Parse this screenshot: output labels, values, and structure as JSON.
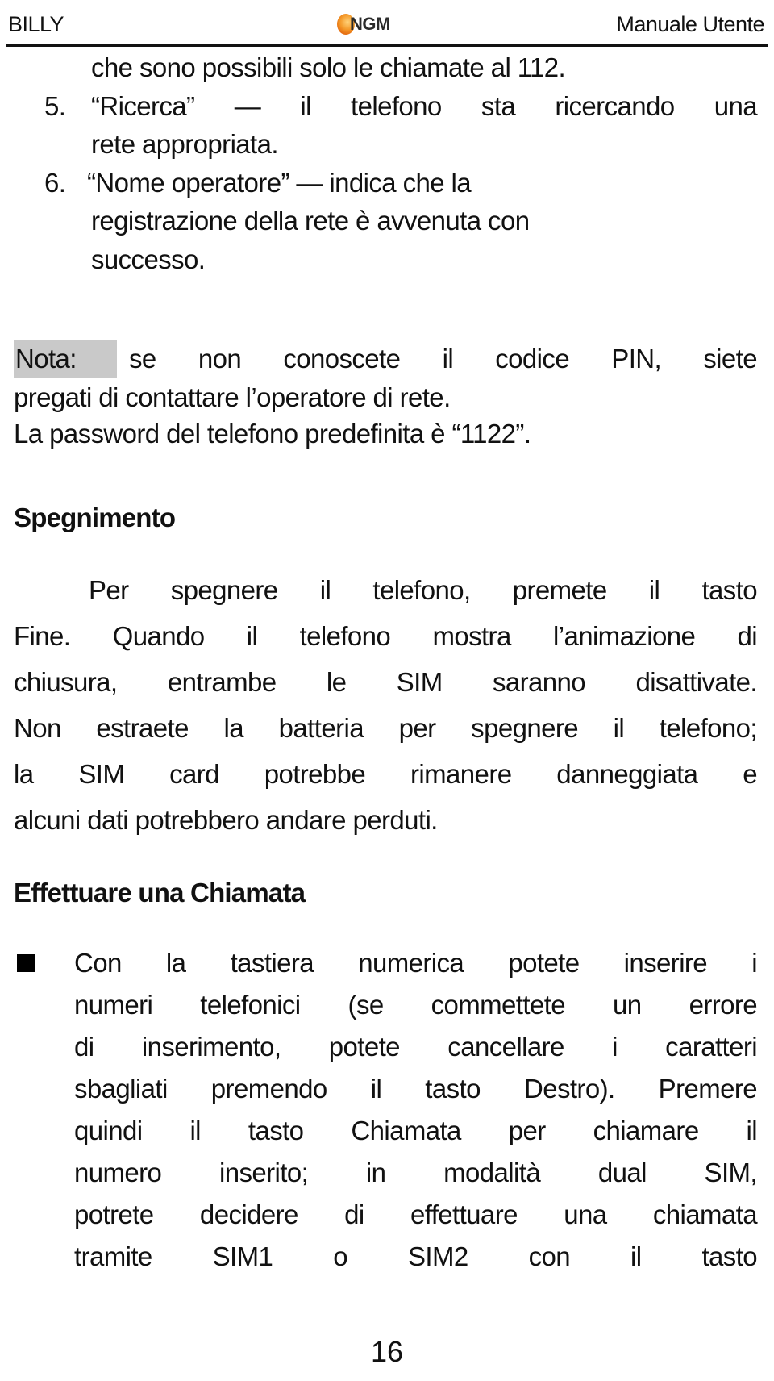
{
  "header": {
    "left": "BILLY",
    "logo_text": "NGM",
    "right": "Manuale Utente",
    "logo_color": "#f49a2a"
  },
  "list_continuation": "che sono possibili solo le chiamate al 112.",
  "list_items": [
    {
      "number": "5.",
      "lines": [
        "“Ricerca”  —  il  telefono  sta  ricercando  una",
        "rete appropriata."
      ]
    },
    {
      "number": "6.",
      "lines": [
        "“Nome operatore”  — indica che la",
        "registrazione della rete è avvenuta con",
        "successo."
      ]
    }
  ],
  "note": {
    "label": "Nota:",
    "line1": "se  non  conoscete  il  codice  PIN,  siete",
    "line2": "pregati di contattare l’operatore di rete.",
    "line3": "La password del telefono predefinita è “1122”.",
    "highlight_color": "#c9c9c9"
  },
  "sections": [
    {
      "heading": "Spegnimento",
      "paragraph_lines": [
        "Per spegnere il telefono, premete il tasto",
        "Fine. Quando il telefono mostra l’animazione di",
        "chiusura, entrambe le SIM saranno disattivate.",
        "Non estraete la batteria per spegnere il telefono;",
        "la SIM card potrebbe rimanere danneggiata e",
        "alcuni dati potrebbero andare perduti."
      ]
    },
    {
      "heading": "Effettuare una Chiamata",
      "bullet_lines": [
        "Con la tastiera numerica potete inserire i",
        "numeri telefonici (se commettete un errore",
        "di inserimento, potete cancellare i caratteri",
        "sbagliati premendo il tasto Destro). Premere",
        "quindi il tasto Chiamata per chiamare il",
        "numero inserito; in modalità dual SIM,",
        "potrete decidere di effettuare una chiamata",
        "tramite SIM1 o SIM2 con il tasto"
      ]
    }
  ],
  "page_number": "16"
}
